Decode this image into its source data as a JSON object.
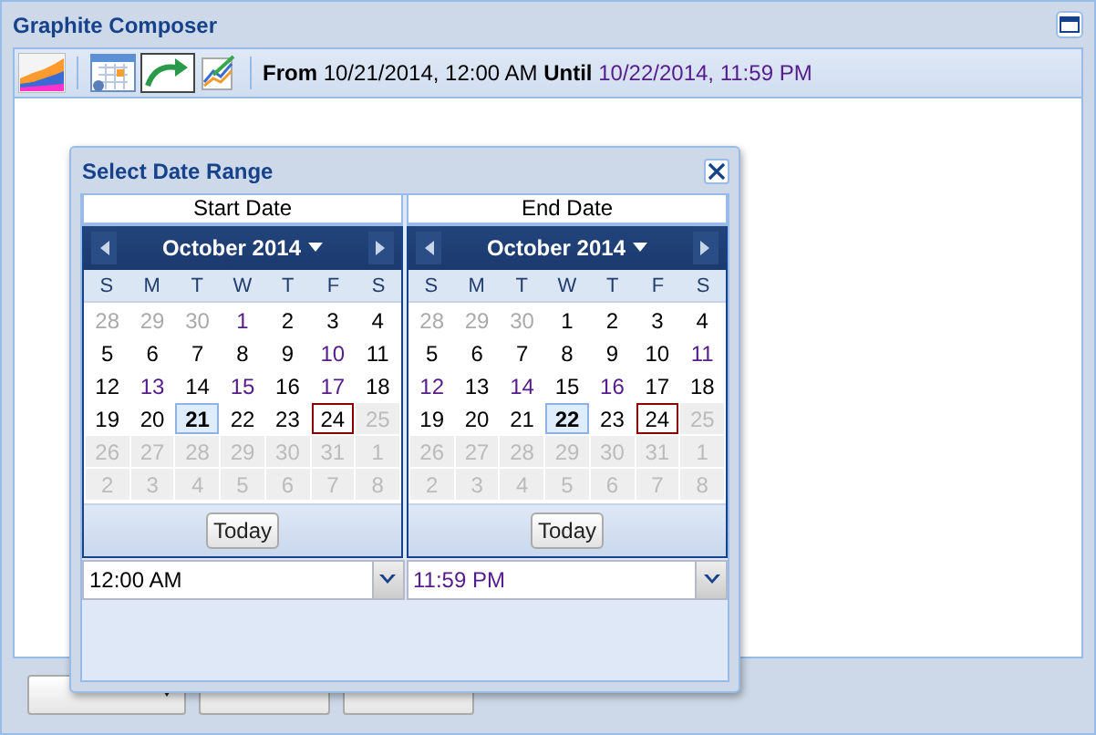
{
  "window": {
    "title": "Graphite Composer"
  },
  "toolbar": {
    "from_label": "From",
    "from_value": "10/21/2014, 12:00 AM",
    "until_label": "Until",
    "until_value": "10/22/2014, 11:59 PM",
    "until_visited": true
  },
  "dialog": {
    "title": "Select Date Range",
    "calendars": [
      {
        "heading": "Start Date",
        "month": "October 2014",
        "weekdays": [
          "S",
          "M",
          "T",
          "W",
          "T",
          "F",
          "S"
        ],
        "today_button": "Today",
        "time": "12:00 AM",
        "time_visited": false,
        "weeks": [
          [
            {
              "label": "28",
              "kind": "other",
              "selected": false,
              "today": false,
              "visited": false
            },
            {
              "label": "29",
              "kind": "other",
              "selected": false,
              "today": false,
              "visited": false
            },
            {
              "label": "30",
              "kind": "other",
              "selected": false,
              "today": false,
              "visited": false
            },
            {
              "label": "1",
              "kind": "day",
              "selected": false,
              "today": false,
              "visited": true
            },
            {
              "label": "2",
              "kind": "day",
              "selected": false,
              "today": false,
              "visited": false
            },
            {
              "label": "3",
              "kind": "day",
              "selected": false,
              "today": false,
              "visited": false
            },
            {
              "label": "4",
              "kind": "day",
              "selected": false,
              "today": false,
              "visited": false
            }
          ],
          [
            {
              "label": "5",
              "kind": "day",
              "selected": false,
              "today": false,
              "visited": false
            },
            {
              "label": "6",
              "kind": "day",
              "selected": false,
              "today": false,
              "visited": false
            },
            {
              "label": "7",
              "kind": "day",
              "selected": false,
              "today": false,
              "visited": false
            },
            {
              "label": "8",
              "kind": "day",
              "selected": false,
              "today": false,
              "visited": false
            },
            {
              "label": "9",
              "kind": "day",
              "selected": false,
              "today": false,
              "visited": false
            },
            {
              "label": "10",
              "kind": "day",
              "selected": false,
              "today": false,
              "visited": true
            },
            {
              "label": "11",
              "kind": "day",
              "selected": false,
              "today": false,
              "visited": false
            }
          ],
          [
            {
              "label": "12",
              "kind": "day",
              "selected": false,
              "today": false,
              "visited": false
            },
            {
              "label": "13",
              "kind": "day",
              "selected": false,
              "today": false,
              "visited": true
            },
            {
              "label": "14",
              "kind": "day",
              "selected": false,
              "today": false,
              "visited": false
            },
            {
              "label": "15",
              "kind": "day",
              "selected": false,
              "today": false,
              "visited": true
            },
            {
              "label": "16",
              "kind": "day",
              "selected": false,
              "today": false,
              "visited": false
            },
            {
              "label": "17",
              "kind": "day",
              "selected": false,
              "today": false,
              "visited": true
            },
            {
              "label": "18",
              "kind": "day",
              "selected": false,
              "today": false,
              "visited": false
            }
          ],
          [
            {
              "label": "19",
              "kind": "day",
              "selected": false,
              "today": false,
              "visited": false
            },
            {
              "label": "20",
              "kind": "day",
              "selected": false,
              "today": false,
              "visited": false
            },
            {
              "label": "21",
              "kind": "day",
              "selected": true,
              "today": false,
              "visited": false
            },
            {
              "label": "22",
              "kind": "day",
              "selected": false,
              "today": false,
              "visited": false
            },
            {
              "label": "23",
              "kind": "day",
              "selected": false,
              "today": false,
              "visited": false
            },
            {
              "label": "24",
              "kind": "day",
              "selected": false,
              "today": true,
              "visited": false
            },
            {
              "label": "25",
              "kind": "disabled",
              "selected": false,
              "today": false,
              "visited": false
            }
          ],
          [
            {
              "label": "26",
              "kind": "disabled",
              "selected": false,
              "today": false,
              "visited": false
            },
            {
              "label": "27",
              "kind": "disabled",
              "selected": false,
              "today": false,
              "visited": false
            },
            {
              "label": "28",
              "kind": "disabled",
              "selected": false,
              "today": false,
              "visited": false
            },
            {
              "label": "29",
              "kind": "disabled",
              "selected": false,
              "today": false,
              "visited": false
            },
            {
              "label": "30",
              "kind": "disabled",
              "selected": false,
              "today": false,
              "visited": false
            },
            {
              "label": "31",
              "kind": "disabled",
              "selected": false,
              "today": false,
              "visited": false
            },
            {
              "label": "1",
              "kind": "disabled",
              "selected": false,
              "today": false,
              "visited": false
            }
          ],
          [
            {
              "label": "2",
              "kind": "disabled",
              "selected": false,
              "today": false,
              "visited": false
            },
            {
              "label": "3",
              "kind": "disabled",
              "selected": false,
              "today": false,
              "visited": false
            },
            {
              "label": "4",
              "kind": "disabled",
              "selected": false,
              "today": false,
              "visited": false
            },
            {
              "label": "5",
              "kind": "disabled",
              "selected": false,
              "today": false,
              "visited": false
            },
            {
              "label": "6",
              "kind": "disabled",
              "selected": false,
              "today": false,
              "visited": false
            },
            {
              "label": "7",
              "kind": "disabled",
              "selected": false,
              "today": false,
              "visited": false
            },
            {
              "label": "8",
              "kind": "disabled",
              "selected": false,
              "today": false,
              "visited": false
            }
          ]
        ]
      },
      {
        "heading": "End Date",
        "month": "October 2014",
        "weekdays": [
          "S",
          "M",
          "T",
          "W",
          "T",
          "F",
          "S"
        ],
        "today_button": "Today",
        "time": "11:59 PM",
        "time_visited": true,
        "weeks": [
          [
            {
              "label": "28",
              "kind": "other",
              "selected": false,
              "today": false,
              "visited": false
            },
            {
              "label": "29",
              "kind": "other",
              "selected": false,
              "today": false,
              "visited": false
            },
            {
              "label": "30",
              "kind": "other",
              "selected": false,
              "today": false,
              "visited": false
            },
            {
              "label": "1",
              "kind": "day",
              "selected": false,
              "today": false,
              "visited": false
            },
            {
              "label": "2",
              "kind": "day",
              "selected": false,
              "today": false,
              "visited": false
            },
            {
              "label": "3",
              "kind": "day",
              "selected": false,
              "today": false,
              "visited": false
            },
            {
              "label": "4",
              "kind": "day",
              "selected": false,
              "today": false,
              "visited": false
            }
          ],
          [
            {
              "label": "5",
              "kind": "day",
              "selected": false,
              "today": false,
              "visited": false
            },
            {
              "label": "6",
              "kind": "day",
              "selected": false,
              "today": false,
              "visited": false
            },
            {
              "label": "7",
              "kind": "day",
              "selected": false,
              "today": false,
              "visited": false
            },
            {
              "label": "8",
              "kind": "day",
              "selected": false,
              "today": false,
              "visited": false
            },
            {
              "label": "9",
              "kind": "day",
              "selected": false,
              "today": false,
              "visited": false
            },
            {
              "label": "10",
              "kind": "day",
              "selected": false,
              "today": false,
              "visited": false
            },
            {
              "label": "11",
              "kind": "day",
              "selected": false,
              "today": false,
              "visited": true
            }
          ],
          [
            {
              "label": "12",
              "kind": "day",
              "selected": false,
              "today": false,
              "visited": true
            },
            {
              "label": "13",
              "kind": "day",
              "selected": false,
              "today": false,
              "visited": false
            },
            {
              "label": "14",
              "kind": "day",
              "selected": false,
              "today": false,
              "visited": true
            },
            {
              "label": "15",
              "kind": "day",
              "selected": false,
              "today": false,
              "visited": false
            },
            {
              "label": "16",
              "kind": "day",
              "selected": false,
              "today": false,
              "visited": true
            },
            {
              "label": "17",
              "kind": "day",
              "selected": false,
              "today": false,
              "visited": false
            },
            {
              "label": "18",
              "kind": "day",
              "selected": false,
              "today": false,
              "visited": false
            }
          ],
          [
            {
              "label": "19",
              "kind": "day",
              "selected": false,
              "today": false,
              "visited": false
            },
            {
              "label": "20",
              "kind": "day",
              "selected": false,
              "today": false,
              "visited": false
            },
            {
              "label": "21",
              "kind": "day",
              "selected": false,
              "today": false,
              "visited": false
            },
            {
              "label": "22",
              "kind": "day",
              "selected": true,
              "today": false,
              "visited": false
            },
            {
              "label": "23",
              "kind": "day",
              "selected": false,
              "today": false,
              "visited": false
            },
            {
              "label": "24",
              "kind": "day",
              "selected": false,
              "today": true,
              "visited": false
            },
            {
              "label": "25",
              "kind": "disabled",
              "selected": false,
              "today": false,
              "visited": false
            }
          ],
          [
            {
              "label": "26",
              "kind": "disabled",
              "selected": false,
              "today": false,
              "visited": false
            },
            {
              "label": "27",
              "kind": "disabled",
              "selected": false,
              "today": false,
              "visited": false
            },
            {
              "label": "28",
              "kind": "disabled",
              "selected": false,
              "today": false,
              "visited": false
            },
            {
              "label": "29",
              "kind": "disabled",
              "selected": false,
              "today": false,
              "visited": false
            },
            {
              "label": "30",
              "kind": "disabled",
              "selected": false,
              "today": false,
              "visited": false
            },
            {
              "label": "31",
              "kind": "disabled",
              "selected": false,
              "today": false,
              "visited": false
            },
            {
              "label": "1",
              "kind": "disabled",
              "selected": false,
              "today": false,
              "visited": false
            }
          ],
          [
            {
              "label": "2",
              "kind": "disabled",
              "selected": false,
              "today": false,
              "visited": false
            },
            {
              "label": "3",
              "kind": "disabled",
              "selected": false,
              "today": false,
              "visited": false
            },
            {
              "label": "4",
              "kind": "disabled",
              "selected": false,
              "today": false,
              "visited": false
            },
            {
              "label": "5",
              "kind": "disabled",
              "selected": false,
              "today": false,
              "visited": false
            },
            {
              "label": "6",
              "kind": "disabled",
              "selected": false,
              "today": false,
              "visited": false
            },
            {
              "label": "7",
              "kind": "disabled",
              "selected": false,
              "today": false,
              "visited": false
            },
            {
              "label": "8",
              "kind": "disabled",
              "selected": false,
              "today": false,
              "visited": false
            }
          ]
        ]
      }
    ]
  },
  "bottom_buttons": [
    {
      "kind": "menu"
    },
    {
      "kind": "plain"
    },
    {
      "kind": "plain"
    }
  ]
}
